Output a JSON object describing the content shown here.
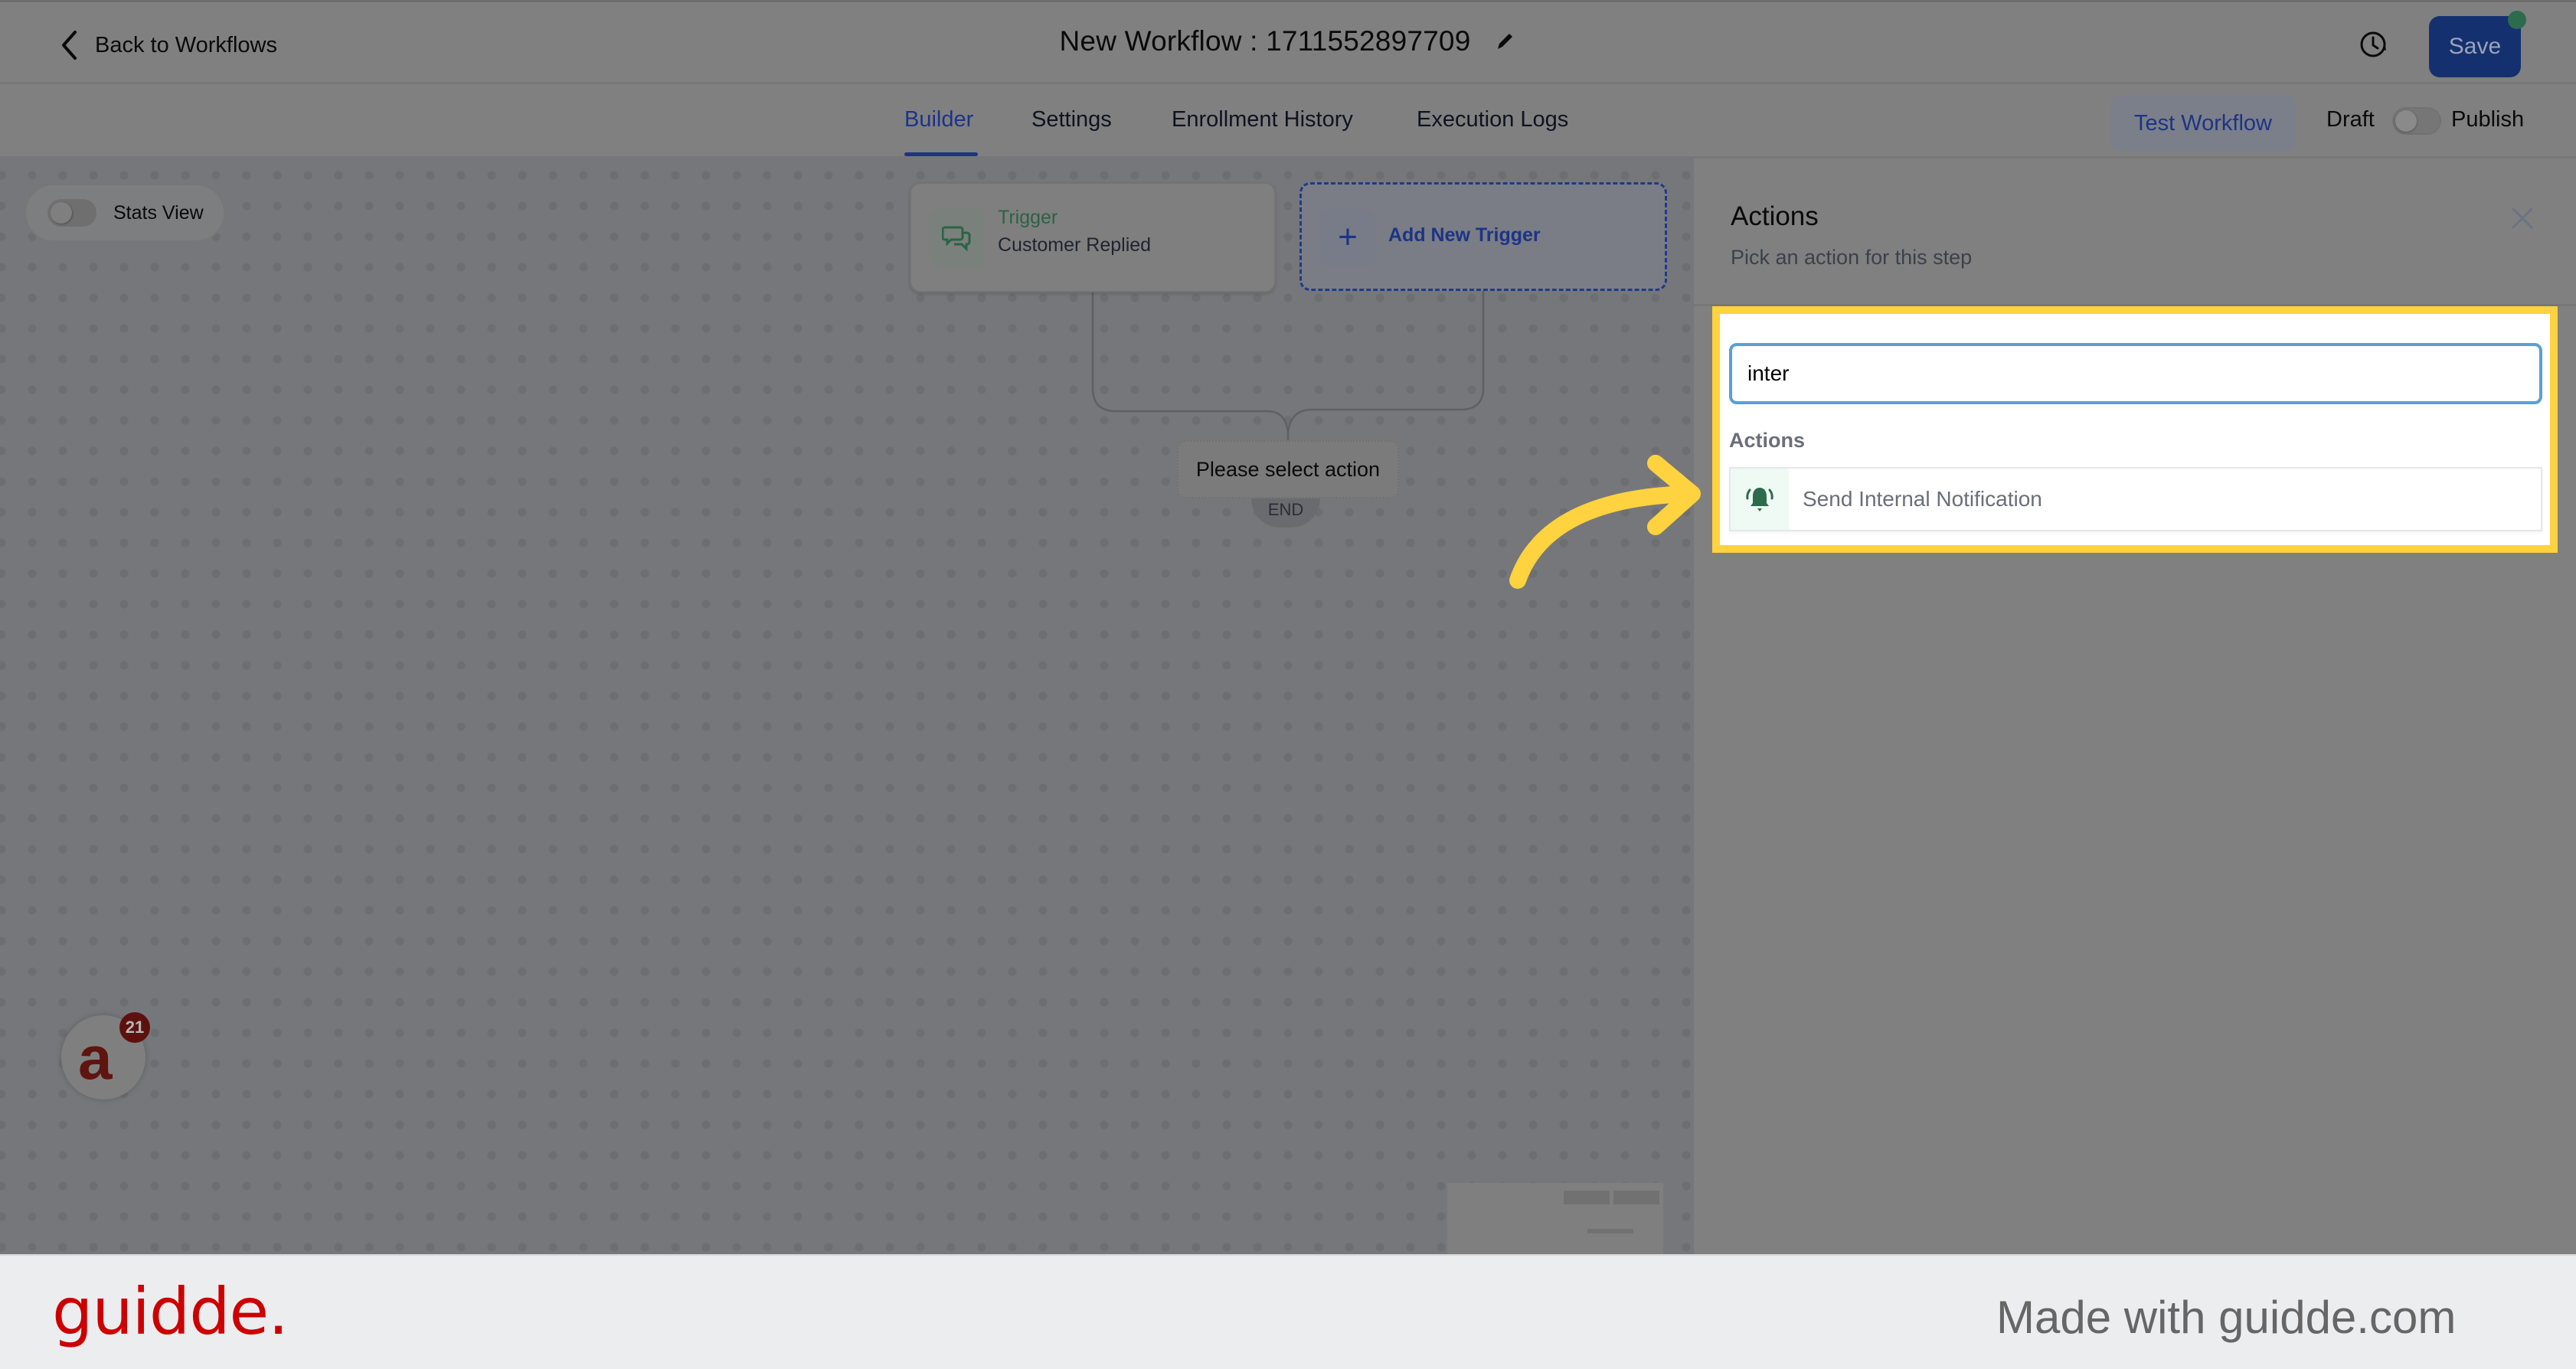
{
  "header": {
    "back_label": "Back to Workflows",
    "title": "New Workflow : 1711552897709",
    "save_label": "Save",
    "icons": {
      "back": "chevron-left-icon",
      "edit": "pencil-icon",
      "history": "clock-history-icon"
    }
  },
  "tabs": [
    {
      "label": "Builder",
      "active": true
    },
    {
      "label": "Settings",
      "active": false
    },
    {
      "label": "Enrollment History",
      "active": false
    },
    {
      "label": "Execution Logs",
      "active": false
    }
  ],
  "toolbar": {
    "test_workflow_label": "Test Workflow",
    "draft_label": "Draft",
    "publish_label": "Publish",
    "publish_toggle_on": false
  },
  "canvas": {
    "stats_view_label": "Stats View",
    "stats_view_on": false,
    "trigger": {
      "label": "Trigger",
      "event": "Customer Replied",
      "icon": "chat-bubbles-icon"
    },
    "add_trigger_label": "Add New Trigger",
    "placeholder_action": "Please select action",
    "end_label": "END"
  },
  "chat_widget": {
    "badge_count": "21"
  },
  "panel": {
    "title": "Actions",
    "subtitle": "Pick an action for this step",
    "search_value": "inter",
    "section_label": "Actions",
    "results": [
      {
        "label": "Send Internal Notification",
        "icon": "bell-ringing-icon"
      }
    ]
  },
  "colors": {
    "accent": "#1d3485",
    "highlight": "#ffd23f",
    "trigger_green": "#2b6344",
    "brand_red": "#cc0000"
  },
  "footer": {
    "logo": "guidde.",
    "made_with": "Made with guidde.com"
  }
}
